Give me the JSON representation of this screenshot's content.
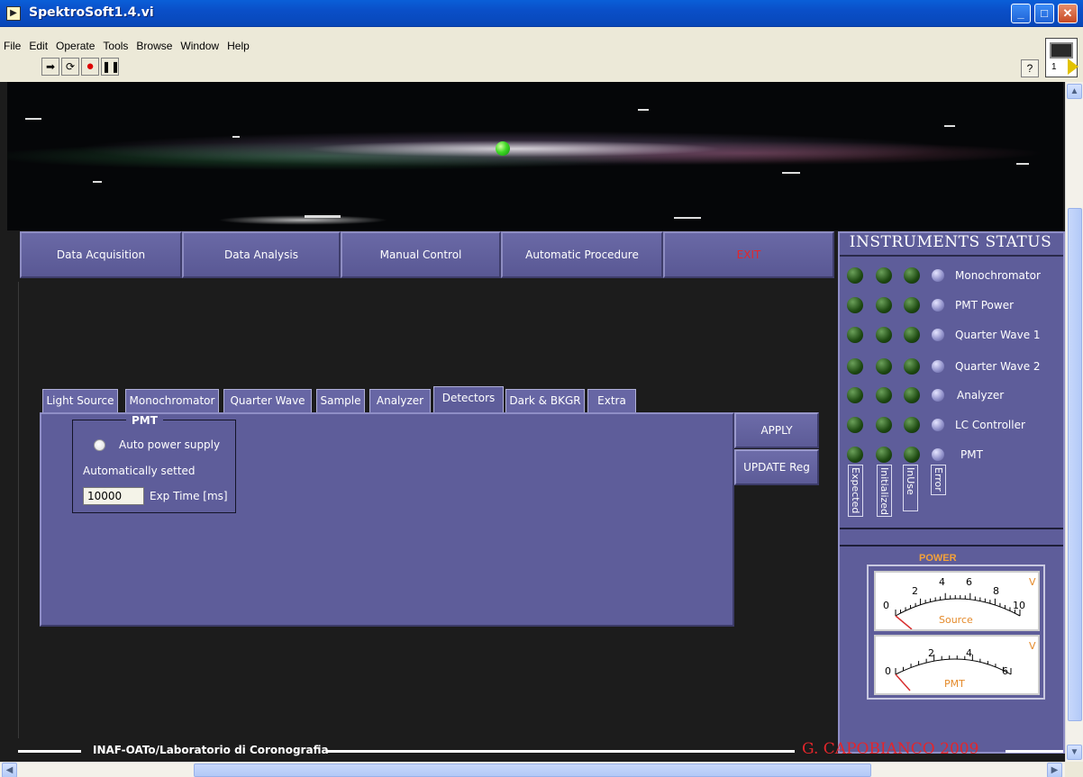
{
  "window": {
    "title": "SpektroSoft1.4.vi"
  },
  "menu": [
    "File",
    "Edit",
    "Operate",
    "Tools",
    "Browse",
    "Window",
    "Help"
  ],
  "toolbar_icons": [
    "run-arrow-icon",
    "run-continuous-icon",
    "abort-icon",
    "pause-icon"
  ],
  "help_label": "?",
  "vi_icon_number": "1",
  "nav": {
    "data_acquisition": "Data Acquisition",
    "data_analysis": "Data Analysis",
    "manual_control": "Manual Control",
    "automatic_procedure": "Automatic Procedure",
    "exit": "EXIT"
  },
  "tabs": [
    "Light Source",
    "Monochromator",
    "Quarter Wave",
    "Sample",
    "Analyzer",
    "Detectors",
    "Dark & BKGR",
    "Extra"
  ],
  "active_tab": "Detectors",
  "pmt": {
    "group_title": "PMT",
    "auto_power_label": "Auto power supply",
    "auto_set_label": "Automatically setted",
    "exp_time_value": "10000",
    "exp_time_label": "Exp Time [ms]"
  },
  "buttons": {
    "apply": "APPLY",
    "update_reg": "UPDATE Reg"
  },
  "status": {
    "title": "INSTRUMENTS STATUS",
    "instruments": [
      "Monochromator",
      "PMT Power",
      "Quarter Wave 1",
      "Quarter Wave 2",
      "Analyzer",
      "LC Controller",
      "PMT"
    ],
    "columns": [
      "Expected",
      "Initialized",
      "InUse",
      "Error"
    ]
  },
  "power": {
    "title": "POWER",
    "source": {
      "label": "Source",
      "unit": "V",
      "ticks": [
        "0",
        "2",
        "4",
        "6",
        "8",
        "10"
      ],
      "value": 0
    },
    "pmt": {
      "label": "PMT",
      "unit": "V",
      "ticks": [
        "0",
        "2",
        "4",
        "6"
      ],
      "value": 0
    }
  },
  "footer": {
    "lab": "INAF-OATo/Laboratorio di Coronografia",
    "author": "G. CAPOBIANCO 2009"
  },
  "colors": {
    "panel": "#5e5d9a",
    "exit_text": "#e4262b",
    "led_green": "#1e4a12",
    "power_title": "#f4a23a"
  }
}
